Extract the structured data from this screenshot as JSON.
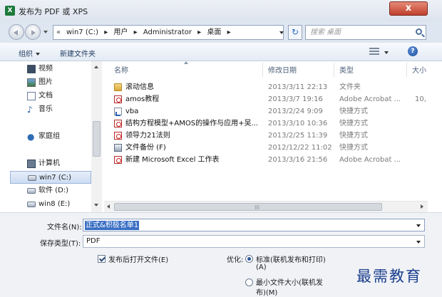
{
  "window": {
    "title": "发布为 PDF 或 XPS",
    "app_icon": "X",
    "close_symbol": "x"
  },
  "address": {
    "chevron": "«",
    "path": [
      "win7 (C:)",
      "用户",
      "Administrator",
      "桌面"
    ],
    "separator": "▸",
    "search_placeholder": "搜索 桌面",
    "refresh_symbol": "↻"
  },
  "toolbar": {
    "organize": "组织",
    "new_folder": "新建文件夹",
    "help_symbol": "?"
  },
  "nav": {
    "items": [
      {
        "label": "视频",
        "icon": "video-icon"
      },
      {
        "label": "图片",
        "icon": "pictures-icon"
      },
      {
        "label": "文档",
        "icon": "documents-icon"
      },
      {
        "label": "音乐",
        "icon": "music-icon"
      },
      {
        "label": "家庭组",
        "icon": "homegroup-icon"
      },
      {
        "label": "计算机",
        "icon": "computer-icon"
      },
      {
        "label": "win7 (C:)",
        "icon": "drive-icon",
        "selected": true
      },
      {
        "label": "软件 (D:)",
        "icon": "drive-icon"
      },
      {
        "label": "win8 (E:)",
        "icon": "drive-icon"
      }
    ]
  },
  "files": {
    "columns": {
      "name": "名称",
      "date": "修改日期",
      "type": "类型",
      "size": "大小"
    },
    "rows": [
      {
        "name": "滚动信息",
        "date": "2013/3/11 22:13",
        "type": "文件夹",
        "size": "",
        "icon": "folder-icon"
      },
      {
        "name": "amos教程",
        "date": "2013/3/7 19:16",
        "type": "Adobe Acrobat ...",
        "size": "10,",
        "icon": "pdf-icon"
      },
      {
        "name": "vba",
        "date": "2013/2/24 9:09",
        "type": "快捷方式",
        "size": "",
        "icon": "shortcut-icon"
      },
      {
        "name": "结构方程模型+AMOS的操作与应用+吴...",
        "date": "2013/3/10 10:36",
        "type": "快捷方式",
        "size": "",
        "icon": "pdf-shortcut-icon"
      },
      {
        "name": "领导力21法则",
        "date": "2013/2/25 11:39",
        "type": "快捷方式",
        "size": "",
        "icon": "pdf-shortcut-icon"
      },
      {
        "name": "文件备份 (F)",
        "date": "2012/12/22 11:02",
        "type": "快捷方式",
        "size": "",
        "icon": "drive-shortcut-icon"
      },
      {
        "name": "新建 Microsoft Excel 工作表",
        "date": "2013/3/16 21:56",
        "type": "Adobe Acrobat ...",
        "size": "",
        "icon": "pdf-icon"
      }
    ],
    "hscroll_grip": "III"
  },
  "form": {
    "filename_label": "文件名(N):",
    "filename_value": "正式&积极名单1",
    "savetype_label": "保存类型(T):",
    "savetype_value": "PDF",
    "open_after_publish": "发布后打开文件(E)",
    "optimize_label": "优化:",
    "opt_standard_line1": "标准(联机发布和打印)",
    "opt_standard_line2": "(A)",
    "opt_min_line1": "最小文件大小(联机发",
    "opt_min_line2": "布)(M)"
  },
  "watermark": "最需教育"
}
